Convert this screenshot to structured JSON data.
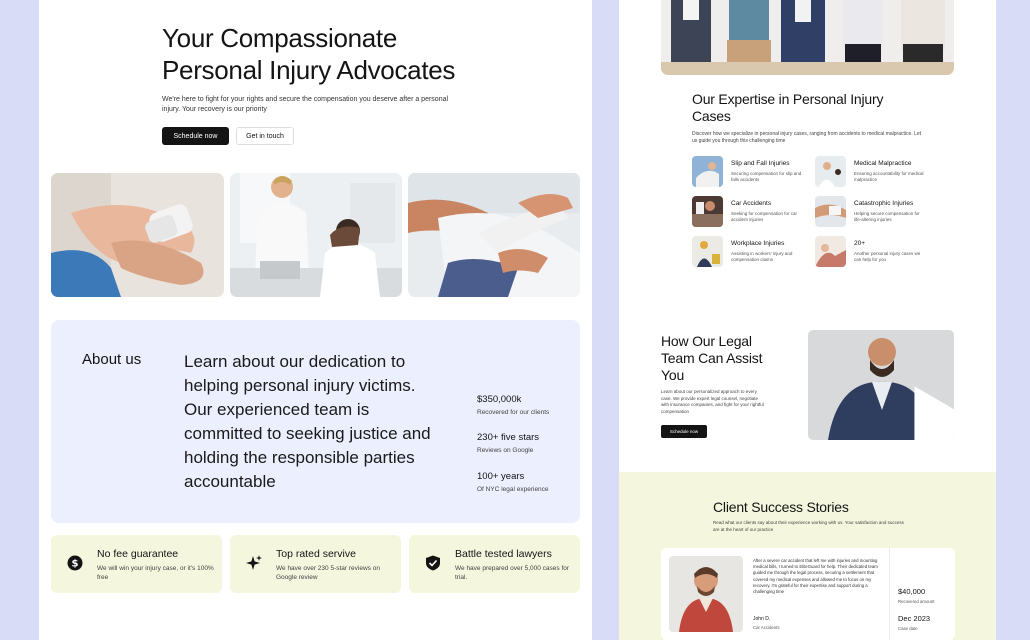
{
  "hero": {
    "title": "Your Compassionate Personal Injury Advocates",
    "subtitle": "We're here to fight for your rights and secure the compensation you deserve after a personal injury. Your recovery is our priority",
    "primary_button": "Schedule now",
    "secondary_button": "Get in touch"
  },
  "about": {
    "heading": "About us",
    "text": "Learn about our dedication to helping personal injury victims. Our experienced team is committed to seeking justice and holding the responsible parties accountable",
    "stats": [
      {
        "value": "$350,000k",
        "label": "Recovered for our clients"
      },
      {
        "value": "230+ five stars",
        "label": "Reviews on Google"
      },
      {
        "value": "100+ years",
        "label": "Of NYC legal experience"
      }
    ]
  },
  "features": [
    {
      "title": "No fee guarantee",
      "desc": "We will win your injury case, or it's 100% free",
      "icon": "dollar-icon"
    },
    {
      "title": "Top rated servive",
      "desc": "We have over 230 5-star reviews on Google review",
      "icon": "sparkle-icon"
    },
    {
      "title": "Battle tested lawyers",
      "desc": "We have prepared over 5,000 cases for trial.",
      "icon": "shield-check-icon"
    }
  ],
  "expertise": {
    "title": "Our Expertise in Personal Injury Cases",
    "subtitle": "Discover how we specialize in personal injury cases, ranging from accidents to medical malpractice. Let us guide you through this challenging time",
    "items": [
      {
        "name": "Slip and Fall Injuries",
        "desc": "Securing compensation for slip and falls accidents"
      },
      {
        "name": "Medical Malpractice",
        "desc": "Ensuring accountability for medical malpractice"
      },
      {
        "name": "Car Accidents",
        "desc": "Seeking for compensation for car accident injuries"
      },
      {
        "name": "Catastrophic Injuries",
        "desc": "Helping secure compensation for life-altering injuries"
      },
      {
        "name": "Workplace Injuries",
        "desc": "Assisting in workers' injury and compensation claims"
      },
      {
        "name": "20+",
        "desc": "Another personal injury cases we can help for you"
      }
    ]
  },
  "assist": {
    "title": "How Our Legal Team Can Assist You",
    "subtitle": "Learn about our personalized approach to every case. We provide expert legal counsel, negotiate with insurance companies, and fight for your rightful compensation",
    "button": "Schedule now"
  },
  "stories": {
    "title": "Client Success Stories",
    "subtitle": "Read what our clients say about their experience working with us. Your satisfaction and success are at the heart of our practice",
    "quote": "After a severe car accident that left me with injuries and mounting medical bills, I turned to EliteGuard for help. Their dedicated team guided me through the legal process, securing a settlement that covered my medical expenses and allowed me to focus on my recovery. I'm grateful for their expertise and support during a challenging time",
    "name": "John D.",
    "role": "Car Accidents",
    "amount": "$40,000",
    "amount_label": "Recovered amount",
    "date": "Dec 2023",
    "date_label": "Case date"
  },
  "colors": {
    "page_bg": "#d8dcf6",
    "about_bg": "#eceffd",
    "feature_bg": "#f4f7de",
    "dark_button": "#141414"
  }
}
